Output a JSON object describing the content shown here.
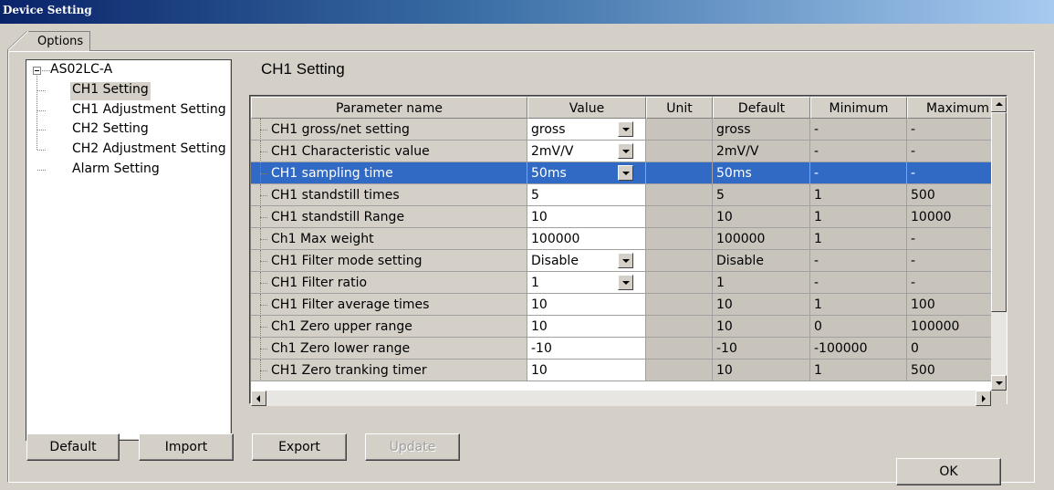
{
  "window": {
    "title": "Device Setting"
  },
  "tabs": [
    {
      "label": "Options"
    }
  ],
  "tree": {
    "root": "AS02LC-A",
    "items": [
      {
        "label": "CH1 Setting",
        "selected": true
      },
      {
        "label": "CH1 Adjustment Setting"
      },
      {
        "label": "CH2 Setting"
      },
      {
        "label": "CH2 Adjustment Setting"
      },
      {
        "label": "Alarm Setting"
      }
    ]
  },
  "section": {
    "title": "CH1 Setting"
  },
  "table": {
    "columns": [
      "Parameter name",
      "Value",
      "Unit",
      "Default",
      "Minimum",
      "Maximum"
    ],
    "rows": [
      {
        "name": "CH1 gross/net setting",
        "value": "gross",
        "unit": "",
        "default": "gross",
        "min": "-",
        "max": "-",
        "dropdown": true
      },
      {
        "name": "CH1 Characteristic value",
        "value": "2mV/V",
        "unit": "",
        "default": "2mV/V",
        "min": "-",
        "max": "-",
        "dropdown": true
      },
      {
        "name": "CH1 sampling time",
        "value": "50ms",
        "unit": "",
        "default": "50ms",
        "min": "-",
        "max": "-",
        "dropdown": true,
        "selected": true
      },
      {
        "name": "CH1 standstill times",
        "value": "5",
        "unit": "",
        "default": "5",
        "min": "1",
        "max": "500"
      },
      {
        "name": "CH1 standstill Range",
        "value": "10",
        "unit": "",
        "default": "10",
        "min": "1",
        "max": "10000"
      },
      {
        "name": "Ch1 Max weight",
        "value": "100000",
        "unit": "",
        "default": "100000",
        "min": "1",
        "max": "-"
      },
      {
        "name": "CH1 Filter mode setting",
        "value": "Disable",
        "unit": "",
        "default": "Disable",
        "min": "-",
        "max": "-",
        "dropdown": true
      },
      {
        "name": "CH1 Filter ratio",
        "value": "1",
        "unit": "",
        "default": "1",
        "min": "-",
        "max": "-",
        "dropdown": true
      },
      {
        "name": "CH1 Filter average times",
        "value": "10",
        "unit": "",
        "default": "10",
        "min": "1",
        "max": "100"
      },
      {
        "name": "Ch1 Zero upper range",
        "value": "10",
        "unit": "",
        "default": "10",
        "min": "0",
        "max": "100000"
      },
      {
        "name": "Ch1 Zero lower range",
        "value": "-10",
        "unit": "",
        "default": "-10",
        "min": "-100000",
        "max": "0"
      },
      {
        "name": "CH1 Zero tranking timer",
        "value": "10",
        "unit": "",
        "default": "10",
        "min": "1",
        "max": "500"
      }
    ]
  },
  "buttons": {
    "default": "Default",
    "import": "Import",
    "export": "Export",
    "update": "Update",
    "ok": "OK"
  },
  "colors": {
    "selection": "#316ac5",
    "face": "#d4d0c8",
    "titlebar_start": "#0a246a",
    "titlebar_end": "#a6caf0"
  }
}
